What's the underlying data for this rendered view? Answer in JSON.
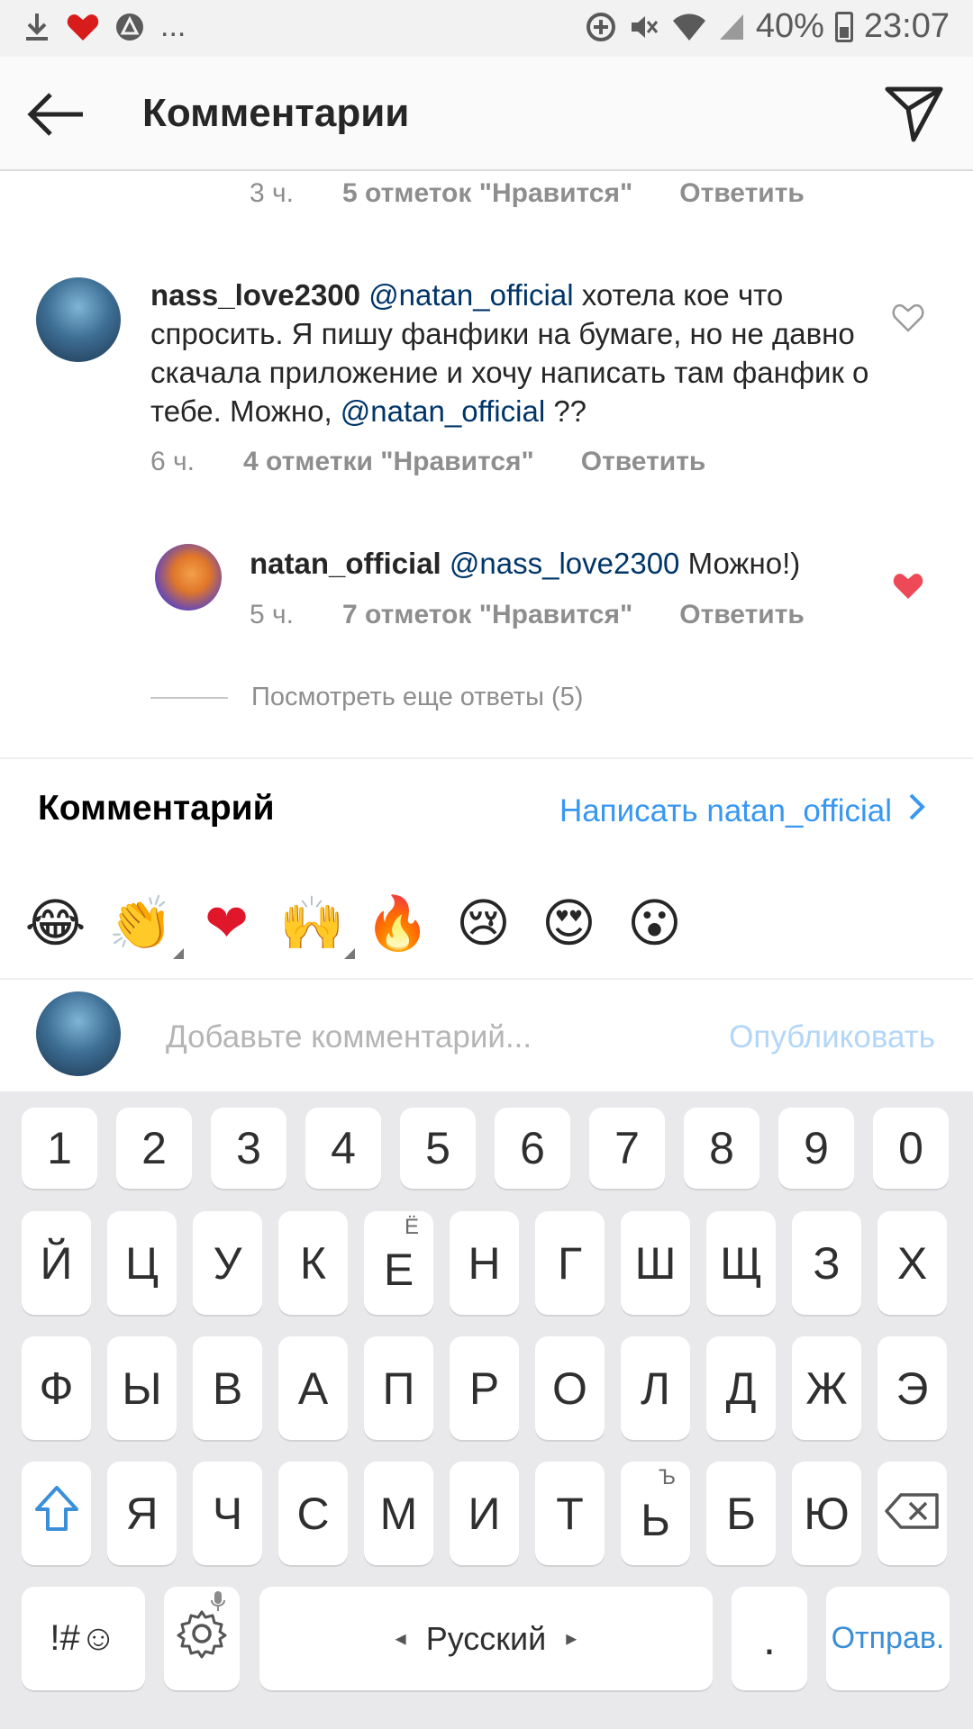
{
  "status_bar": {
    "more": "...",
    "battery": "40%",
    "time": "23:07"
  },
  "header": {
    "title": "Комментарии"
  },
  "prev_comment_meta": {
    "time": "3 ч.",
    "likes": "5 отметок \"Нравится\"",
    "reply": "Ответить"
  },
  "comment": {
    "username": "nass_love2300",
    "mention1": "@natan_official",
    "text1": "хотела кое что спросить. Я пишу фанфики на бумаге, но не давно скачала приложение и хочу написать там фанфик о тебе. Можно,",
    "mention2": "@natan_official",
    "text2": "??",
    "time": "6 ч.",
    "likes": "4 отметки \"Нравится\"",
    "reply": "Ответить"
  },
  "reply_comment": {
    "username": "natan_official",
    "mention": "@nass_love2300",
    "text": "Можно!)",
    "time": "5 ч.",
    "likes": "7 отметок \"Нравится\"",
    "reply": "Ответить"
  },
  "more_replies": "Посмотреть еще ответы (5)",
  "composer": {
    "label": "Комментарий",
    "write_to": "Написать natan_official",
    "placeholder": "Добавьте комментарий...",
    "publish": "Опубликовать"
  },
  "emojis": [
    "😂",
    "👏",
    "❤",
    "🙌",
    "🔥",
    "😢",
    "😍",
    "😮"
  ],
  "keyboard": {
    "row_numbers": [
      "1",
      "2",
      "3",
      "4",
      "5",
      "6",
      "7",
      "8",
      "9",
      "0"
    ],
    "row1": [
      "Й",
      "Ц",
      "У",
      "К",
      "Е",
      "Н",
      "Г",
      "Ш",
      "Щ",
      "З",
      "Х"
    ],
    "row1_hint_e": "Ё",
    "row2": [
      "Ф",
      "Ы",
      "В",
      "А",
      "П",
      "Р",
      "О",
      "Л",
      "Д",
      "Ж",
      "Э"
    ],
    "row3": [
      "Я",
      "Ч",
      "С",
      "М",
      "И",
      "Т",
      "Ь",
      "Б",
      "Ю"
    ],
    "row3_hint_soft": "Ъ",
    "symbols": "!#☺",
    "space": "Русский",
    "period": ".",
    "send": "Отправ."
  }
}
